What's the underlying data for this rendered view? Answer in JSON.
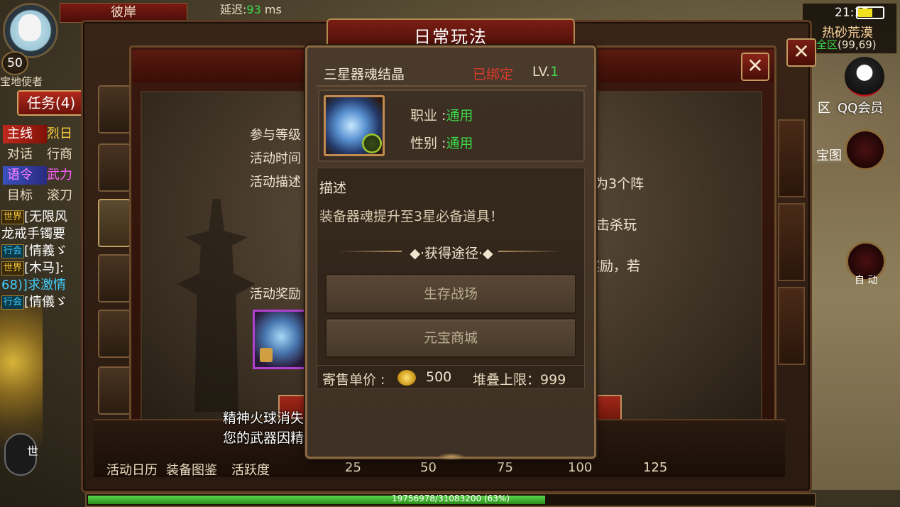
{
  "hud": {
    "player_level": "50",
    "player_name": "彼岸",
    "latency_label": "延迟:",
    "latency_value": "93",
    "latency_unit": " ms",
    "quest_top_text": "宝地使者",
    "quest_button": "任务(4)",
    "quest_rows": [
      {
        "tag": "主线",
        "text": "烈日",
        "style": "red"
      },
      {
        "tag": "对话",
        "text": "行商",
        "style": "plain"
      },
      {
        "tag": "语令",
        "text": "武力",
        "style": "blue"
      },
      {
        "tag": "目标",
        "text": "滚刀",
        "style": "plain"
      }
    ],
    "chat_lines": [
      {
        "channel": "世界",
        "channel_type": "world",
        "text": "[无限风"
      },
      {
        "channel": "",
        "channel_type": "",
        "text": "龙戒手镯要"
      },
      {
        "channel": "行会",
        "channel_type": "guild",
        "text": "[情義ゞ"
      },
      {
        "channel": "世界",
        "channel_type": "world",
        "text": "[木马]:"
      },
      {
        "channel": "",
        "channel_type": "",
        "text": "68)]求激情",
        "cyan_prefix": "68)]"
      },
      {
        "channel": "行会",
        "channel_type": "guild",
        "text": "[情儀ゞ"
      }
    ],
    "mic_label": "世",
    "clock": "21:12",
    "battery_level": 0.6,
    "map_name": "热砂荒漠",
    "map_zone": "全区",
    "map_coords": "(99,69)",
    "qq_label": "QQ会员",
    "qu_label": "区",
    "treasure_map_label": "宝图",
    "auto_label": "自 动"
  },
  "back_panel": {
    "title": "日常玩法",
    "close_icon": "close-icon"
  },
  "activity": {
    "info_lines": [
      "参与等级",
      "活动时间",
      "活动描述"
    ],
    "info_right": [
      "为3个阵",
      "击杀玩",
      "奖励，若"
    ],
    "reward_label": "活动奖励",
    "system_messages": [
      "精神火球消失",
      "您的武器因精神火球而炙热"
    ],
    "bottom_labels": [
      "活动日历",
      "装备图鉴",
      "活跃度"
    ],
    "milestones": [
      "25",
      "50",
      "75",
      "100",
      "125"
    ]
  },
  "exp": {
    "text": "19756978/31083200 (63%)",
    "fraction": 0.63
  },
  "tooltip": {
    "item_name": "三星器魂结晶",
    "bound_status": "已绑定",
    "level_label": "LV.",
    "level_value": "1",
    "profession_label": "职业 :",
    "profession_value": "通用",
    "gender_label": "性别 :",
    "gender_value": "通用",
    "desc_title": "描述",
    "desc_text": "装备器魂提升至3星必备道具！",
    "source_title": "获得途径",
    "sources": [
      "生存战场",
      "元宝商城"
    ],
    "price_label": "寄售单价 :",
    "price_value": "500",
    "stack_label": "堆叠上限：",
    "stack_value": "999"
  }
}
